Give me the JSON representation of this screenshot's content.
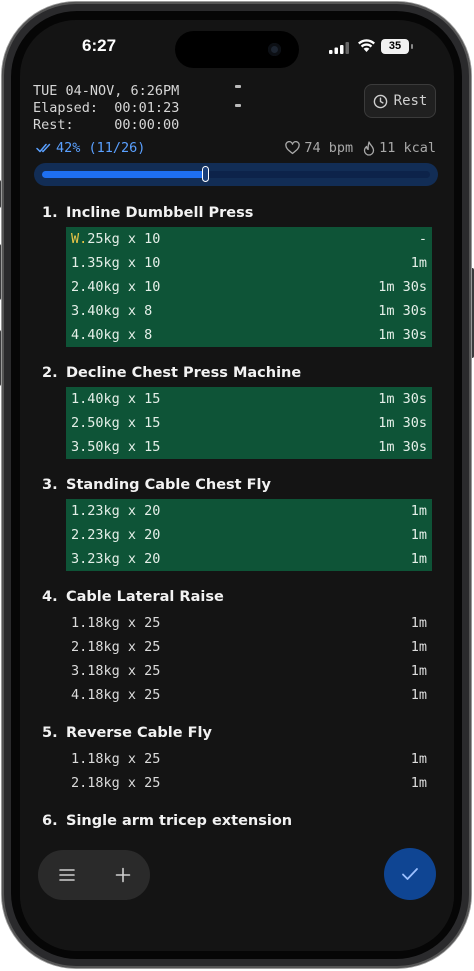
{
  "status_bar": {
    "time": "6:27",
    "battery": "35"
  },
  "header": {
    "date": "TUE 04-NOV, 6:26PM",
    "elapsed_label": "Elapsed:",
    "elapsed_value": "00:01:23",
    "rest_label": "Rest:",
    "rest_value": "00:00:00",
    "rest_button": "Rest"
  },
  "progress": {
    "text": "42% (11/26)",
    "fraction": 0.42,
    "heart_rate": "74 bpm",
    "calories": "11 kcal"
  },
  "exercises": [
    {
      "num": "1.",
      "name": "Incline Dumbbell Press",
      "sets": [
        {
          "idx": "W.",
          "warmup": true,
          "text": "25kg x 10",
          "rest": "-",
          "done": true
        },
        {
          "idx": "1.",
          "text": "35kg x 10",
          "rest": "1m",
          "done": true
        },
        {
          "idx": "2.",
          "text": "40kg x 10",
          "rest": "1m 30s",
          "done": true
        },
        {
          "idx": "3.",
          "text": "40kg x 8",
          "rest": "1m 30s",
          "done": true
        },
        {
          "idx": "4.",
          "text": "40kg x 8",
          "rest": "1m 30s",
          "done": true
        }
      ]
    },
    {
      "num": "2.",
      "name": "Decline Chest Press Machine",
      "sets": [
        {
          "idx": "1.",
          "text": "40kg x 15",
          "rest": "1m 30s",
          "done": true
        },
        {
          "idx": "2.",
          "text": "50kg x 15",
          "rest": "1m 30s",
          "done": true
        },
        {
          "idx": "3.",
          "text": "50kg x 15",
          "rest": "1m 30s",
          "done": true
        }
      ]
    },
    {
      "num": "3.",
      "name": "Standing Cable Chest Fly",
      "sets": [
        {
          "idx": "1.",
          "text": "23kg x 20",
          "rest": "1m",
          "done": true
        },
        {
          "idx": "2.",
          "text": "23kg x 20",
          "rest": "1m",
          "done": true
        },
        {
          "idx": "3.",
          "text": "23kg x 20",
          "rest": "1m",
          "done": true
        }
      ]
    },
    {
      "num": "4.",
      "name": "Cable Lateral Raise",
      "sets": [
        {
          "idx": "1.",
          "text": "18kg x 25",
          "rest": "1m",
          "done": false
        },
        {
          "idx": "2.",
          "text": "18kg x 25",
          "rest": "1m",
          "done": false
        },
        {
          "idx": "3.",
          "text": "18kg x 25",
          "rest": "1m",
          "done": false
        },
        {
          "idx": "4.",
          "text": "18kg x 25",
          "rest": "1m",
          "done": false
        }
      ]
    },
    {
      "num": "5.",
      "name": "Reverse Cable Fly",
      "sets": [
        {
          "idx": "1.",
          "text": "18kg x 25",
          "rest": "1m",
          "done": false
        },
        {
          "idx": "2.",
          "text": "18kg x 25",
          "rest": "1m",
          "done": false
        }
      ]
    },
    {
      "num": "6.",
      "name": "Single arm tricep extension",
      "sets": []
    }
  ],
  "colors": {
    "completed_row": "#0e5437",
    "accent_blue": "#1e6ff0",
    "warmup": "#e8c547",
    "fab": "#0f4593"
  },
  "icons": {
    "rest_button": "clock-icon",
    "progress": "double-check-icon",
    "heart_rate": "heart-icon",
    "calories": "flame-icon",
    "menu": "hamburger-icon",
    "add": "plus-icon",
    "finish": "check-icon"
  }
}
